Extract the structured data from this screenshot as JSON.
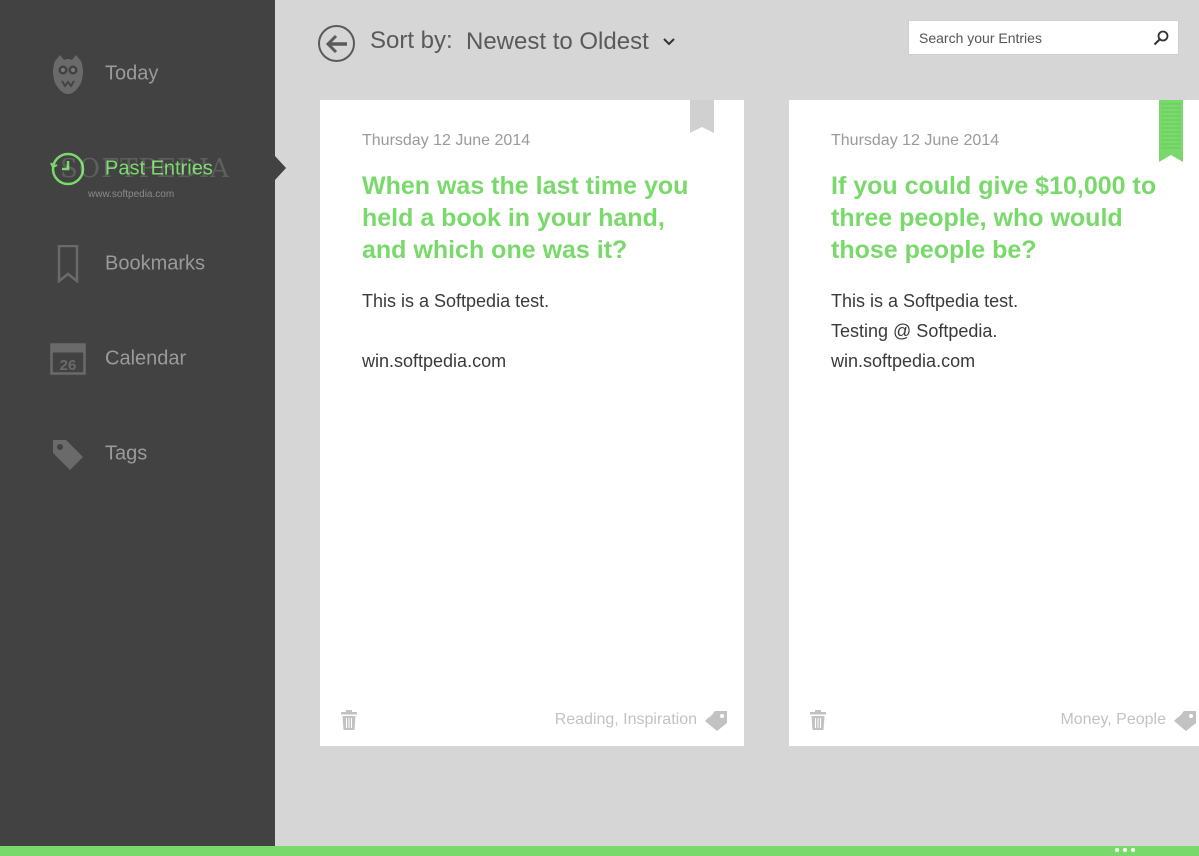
{
  "sidebar": {
    "items": [
      {
        "label": "Today",
        "icon": "owl-icon"
      },
      {
        "label": "Past Entries",
        "icon": "clock-back-icon"
      },
      {
        "label": "Bookmarks",
        "icon": "bookmark-icon"
      },
      {
        "label": "Calendar",
        "icon": "calendar-icon",
        "icon_text": "26"
      },
      {
        "label": "Tags",
        "icon": "tag-icon"
      }
    ],
    "active_index": 1,
    "watermark": "SOFTPEDIA",
    "watermark_url": "www.softpedia.com"
  },
  "header": {
    "sort_label": "Sort by:",
    "sort_value": "Newest to Oldest",
    "search_placeholder": "Search your Entries"
  },
  "entries": [
    {
      "date": "Thursday 12 June 2014",
      "title": "When was the last time you held a book in your hand, and which one was it?",
      "body": [
        "This is a Softpedia test.",
        "",
        "win.softpedia.com"
      ],
      "tags": "Reading, Inspiration",
      "bookmarked": false
    },
    {
      "date": "Thursday 12 June 2014",
      "title": "If you could give $10,000 to three people, who would those people be?",
      "body": [
        "This is a Softpedia test.",
        "Testing @ Softpedia.",
        "win.softpedia.com"
      ],
      "tags": "Money, People",
      "bookmarked": true
    }
  ],
  "colors": {
    "accent": "#79d96b",
    "sidebar_bg": "#424242",
    "content_bg": "#d6d6d6",
    "card_bg": "#ffffff"
  }
}
